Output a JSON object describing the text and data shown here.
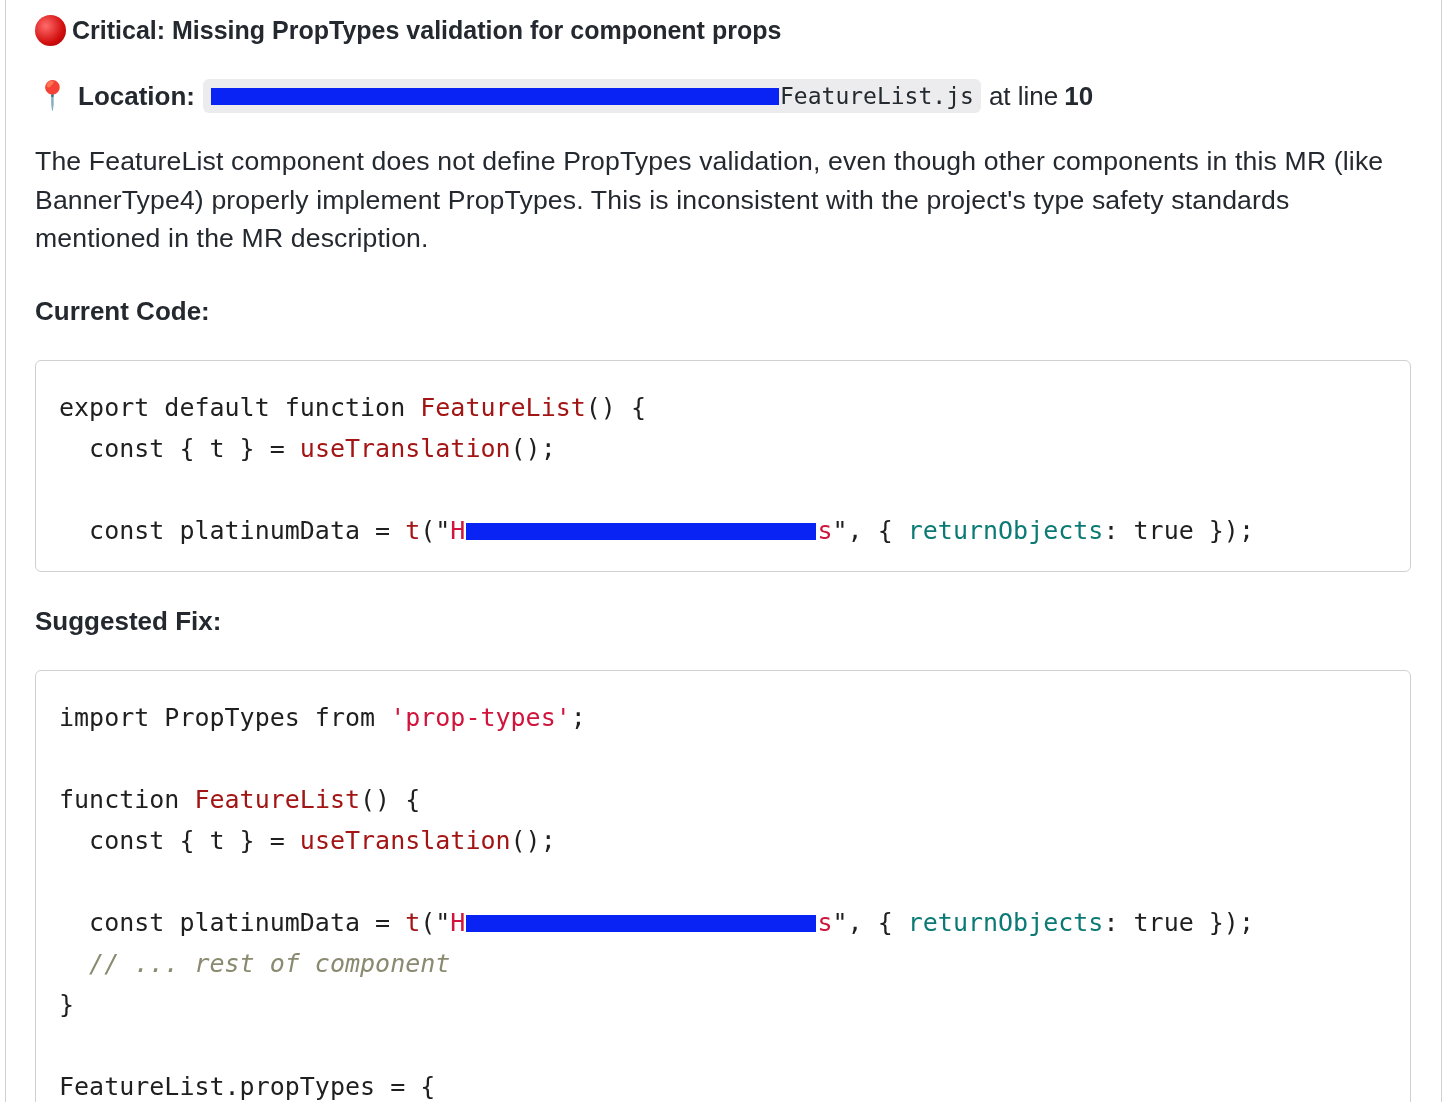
{
  "issue": {
    "title": "Critical: Missing PropTypes validation for component props"
  },
  "location": {
    "icon": "📍",
    "label": "Location:",
    "path": [
      {
        "kind": "redacted"
      },
      {
        "kind": "text",
        "text": "FeatureList.js"
      }
    ],
    "line_prefix": "at line",
    "line": "10"
  },
  "description": "The FeatureList component does not define PropTypes validation, even though other components in this MR (like BannerType4) properly implement PropTypes. This is inconsistent with the project's type safety standards mentioned in the MR description.",
  "sections": [
    {
      "heading": "Current Code:",
      "code": [
        {
          "tokens": [
            {
              "kind": "plain",
              "text": "export default function "
            },
            {
              "kind": "func",
              "text": "FeatureList"
            },
            {
              "kind": "plain",
              "text": "() {"
            }
          ]
        },
        {
          "tokens": [
            {
              "kind": "plain",
              "text": "  const { t } = "
            },
            {
              "kind": "func",
              "text": "useTranslation"
            },
            {
              "kind": "plain",
              "text": "();"
            }
          ]
        },
        {
          "tokens": [
            {
              "kind": "blank"
            }
          ]
        },
        {
          "tokens": [
            {
              "kind": "plain",
              "text": "  const platinumData = "
            },
            {
              "kind": "func",
              "text": "t"
            },
            {
              "kind": "plain",
              "text": "(\""
            },
            {
              "kind": "string",
              "text": "H"
            },
            {
              "kind": "redacted"
            },
            {
              "kind": "string",
              "text": "s"
            },
            {
              "kind": "plain",
              "text": "\", { "
            },
            {
              "kind": "prop",
              "text": "returnObjects"
            },
            {
              "kind": "plain",
              "text": ": true });"
            }
          ]
        }
      ]
    },
    {
      "heading": "Suggested Fix:",
      "code": [
        {
          "tokens": [
            {
              "kind": "plain",
              "text": "import PropTypes from "
            },
            {
              "kind": "string",
              "text": "'prop-types'"
            },
            {
              "kind": "plain",
              "text": ";"
            }
          ]
        },
        {
          "tokens": [
            {
              "kind": "blank"
            }
          ]
        },
        {
          "tokens": [
            {
              "kind": "plain",
              "text": "function "
            },
            {
              "kind": "func",
              "text": "FeatureList"
            },
            {
              "kind": "plain",
              "text": "() {"
            }
          ]
        },
        {
          "tokens": [
            {
              "kind": "plain",
              "text": "  const { t } = "
            },
            {
              "kind": "func",
              "text": "useTranslation"
            },
            {
              "kind": "plain",
              "text": "();"
            }
          ]
        },
        {
          "tokens": [
            {
              "kind": "blank"
            }
          ]
        },
        {
          "tokens": [
            {
              "kind": "plain",
              "text": "  const platinumData = "
            },
            {
              "kind": "func",
              "text": "t"
            },
            {
              "kind": "plain",
              "text": "(\""
            },
            {
              "kind": "string",
              "text": "H"
            },
            {
              "kind": "redacted"
            },
            {
              "kind": "string",
              "text": "s"
            },
            {
              "kind": "plain",
              "text": "\", { "
            },
            {
              "kind": "prop",
              "text": "returnObjects"
            },
            {
              "kind": "plain",
              "text": ": true });"
            }
          ]
        },
        {
          "tokens": [
            {
              "kind": "comment",
              "text": "  // ... rest of component"
            }
          ]
        },
        {
          "tokens": [
            {
              "kind": "plain",
              "text": "}"
            }
          ]
        },
        {
          "tokens": [
            {
              "kind": "blank"
            }
          ]
        },
        {
          "tokens": [
            {
              "kind": "plain",
              "text": "FeatureList.propTypes = {"
            }
          ]
        }
      ]
    }
  ]
}
